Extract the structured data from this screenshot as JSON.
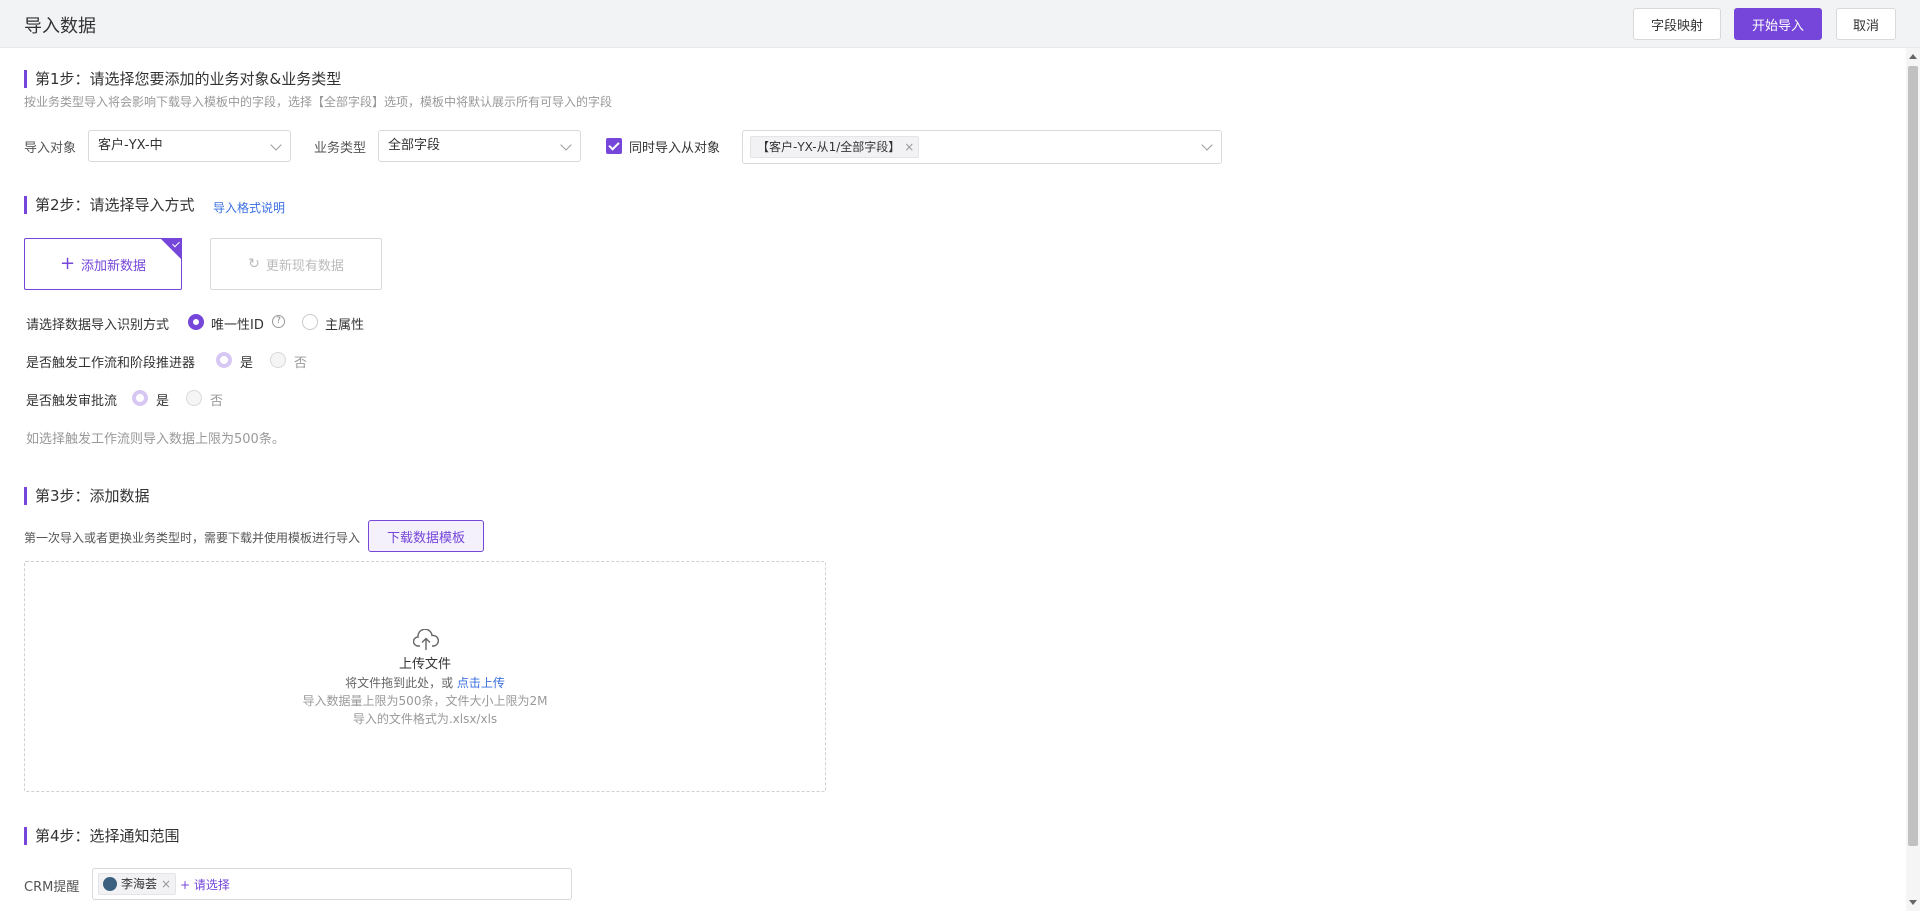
{
  "header": {
    "title": "导入数据",
    "field_mapping_button": "字段映射",
    "start_import_button": "开始导入",
    "cancel_button": "取消"
  },
  "step1": {
    "title": "第1步：请选择您要添加的业务对象&业务类型",
    "hint": "按业务类型导入将会影响下载导入模板中的字段，选择【全部字段】选项，模板中将默认展示所有可导入的字段",
    "import_object_label": "导入对象",
    "import_object_value": "客户-YX-中",
    "business_type_label": "业务类型",
    "business_type_value": "全部字段",
    "sub_object_checkbox_label": "同时导入从对象",
    "sub_object_checked": true,
    "sub_object_tag": "【客户-YX-从1/全部字段】"
  },
  "step2": {
    "title": "第2步：请选择导入方式",
    "format_link": "导入格式说明",
    "add_new_card": "添加新数据",
    "update_existing_card": "更新现有数据",
    "identify_label": "请选择数据导入识别方式",
    "identify_options": [
      "唯一性ID",
      "主属性"
    ],
    "identify_selected": "唯一性ID",
    "workflow_label": "是否触发工作流和阶段推进器",
    "workflow_options": [
      "是",
      "否"
    ],
    "approval_label": "是否触发审批流",
    "approval_options": [
      "是",
      "否"
    ],
    "note": "如选择触发工作流则导入数据上限为500条。"
  },
  "step3": {
    "title": "第3步：添加数据",
    "hint": "第一次导入或者更换业务类型时，需要下载并使用模板进行导入",
    "download_button": "下载数据模板",
    "upload_title": "上传文件",
    "upload_drag_text": "将文件拖到此处，或",
    "upload_click_link": "点击上传",
    "upload_limit": "导入数据量上限为500条，文件大小上限为2M",
    "upload_format": "导入的文件格式为.xlsx/xls"
  },
  "step4": {
    "title": "第4步：选择通知范围",
    "crm_label": "CRM提醒",
    "user_tag": "李海荟",
    "add_placeholder": "+ 请选择"
  },
  "colors": {
    "accent": "#7546d9",
    "link": "#3a6fe0"
  }
}
